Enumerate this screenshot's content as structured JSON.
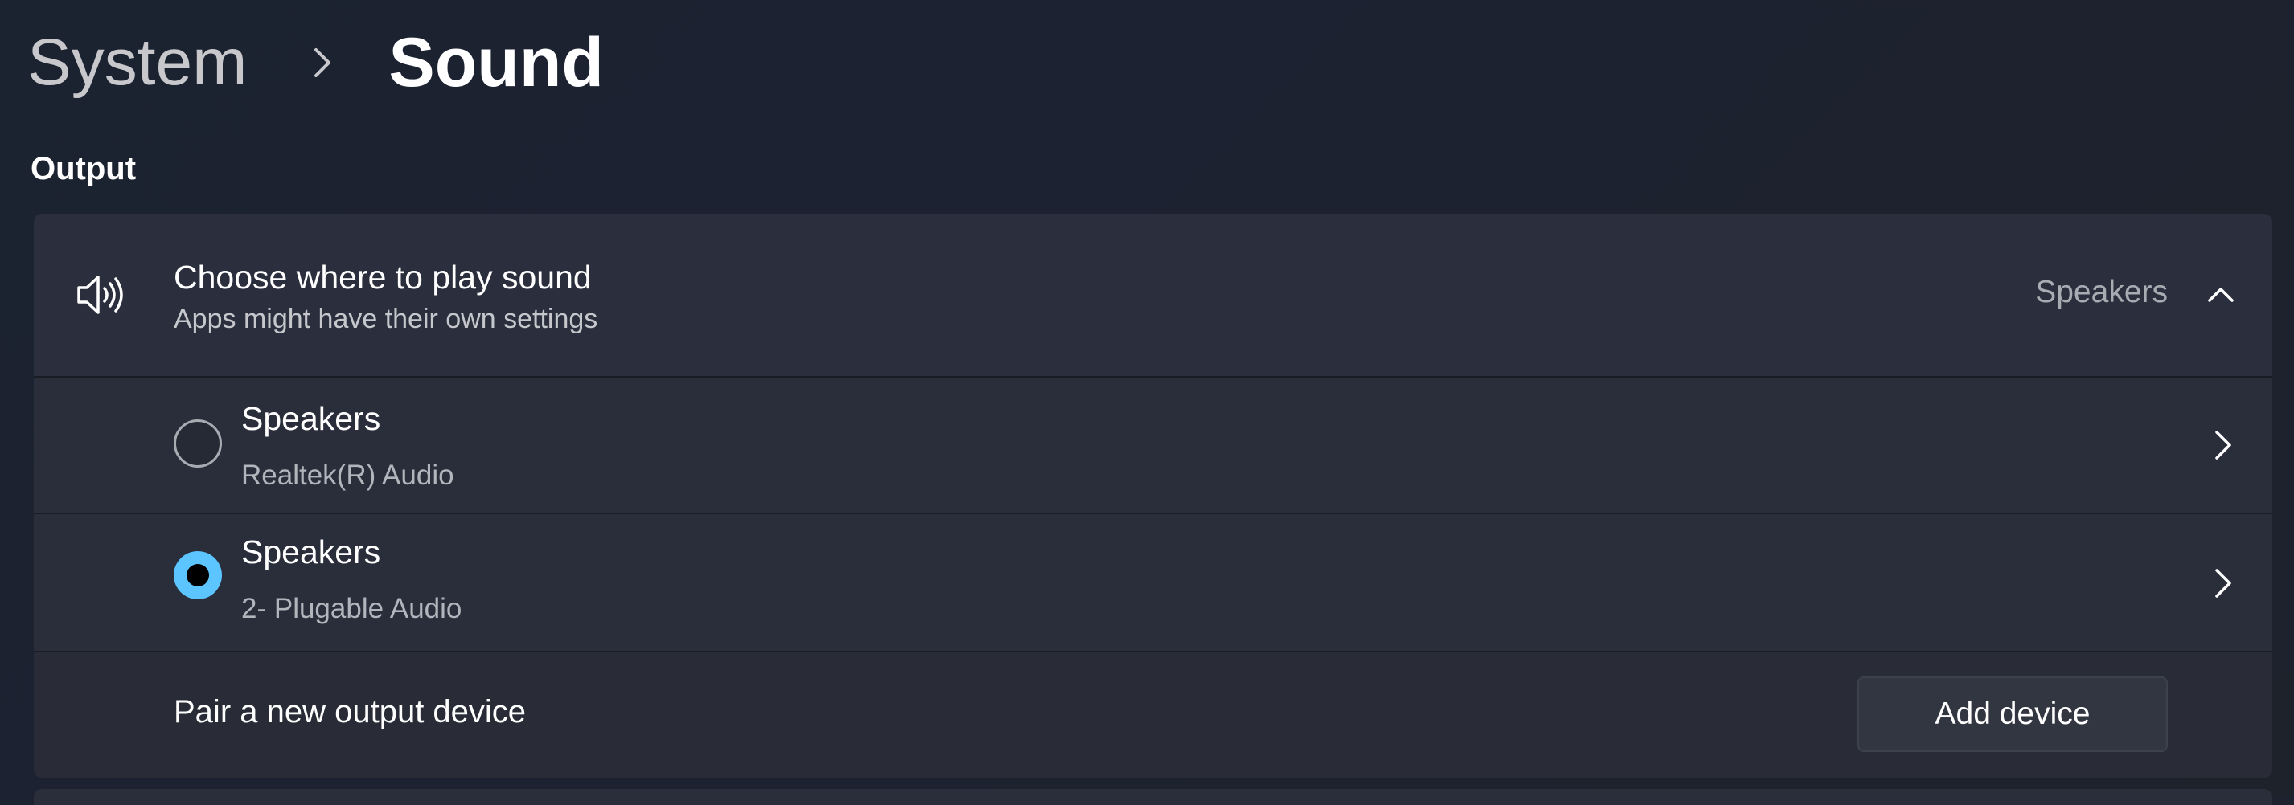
{
  "breadcrumb": {
    "parent": "System",
    "current": "Sound"
  },
  "section": {
    "title": "Output"
  },
  "output_picker": {
    "icon": "speaker-icon",
    "title": "Choose where to play sound",
    "subtitle": "Apps might have their own settings",
    "selected_value": "Speakers",
    "expanded": true,
    "devices": [
      {
        "name": "Speakers",
        "description": "Realtek(R) Audio",
        "selected": false
      },
      {
        "name": "Speakers",
        "description": "2- Plugable Audio",
        "selected": true
      }
    ]
  },
  "pair": {
    "label": "Pair a new output device",
    "button_label": "Add device"
  },
  "colors": {
    "accent": "#5cc5ff",
    "card_background": "#2a2e3b",
    "page_background": "#1c2231"
  }
}
